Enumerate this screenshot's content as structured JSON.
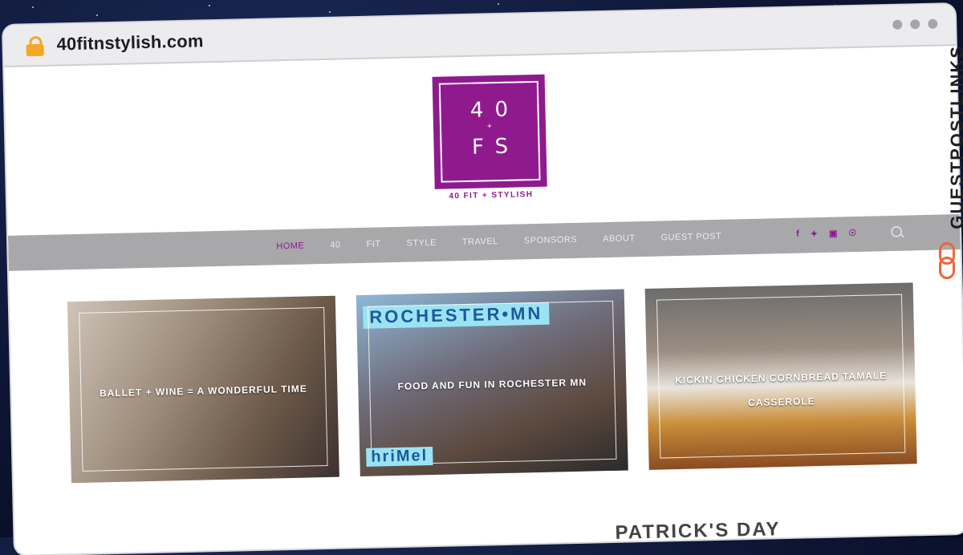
{
  "browser": {
    "url": "40fitnstylish.com"
  },
  "logo": {
    "line1": "40",
    "plus": "+",
    "line2": "FS",
    "tagline": "40 FIT + STYLISH"
  },
  "nav": {
    "items": [
      {
        "label": "HOME",
        "active": true
      },
      {
        "label": "40"
      },
      {
        "label": "FIT"
      },
      {
        "label": "STYLE"
      },
      {
        "label": "TRAVEL"
      },
      {
        "label": "SPONSORS"
      },
      {
        "label": "ABOUT"
      },
      {
        "label": "GUEST POST"
      }
    ],
    "social": [
      "f",
      "twitter",
      "instagram",
      "pinterest"
    ]
  },
  "cards": [
    {
      "title": "BALLET + WINE = A WONDERFUL TIME"
    },
    {
      "title": "FOOD AND FUN IN ROCHESTER MN",
      "banner_top": "ROCHESTER•MN",
      "banner_bottom": "hriMel"
    },
    {
      "title": "KICKIN CHICKEN CORNBREAD TAMALE CASSEROLE"
    }
  ],
  "bottom_heading": "PATRICK'S DAY",
  "watermark": "GUESTPOSTLINKS",
  "colors": {
    "brand": "#8e1a8e",
    "nav_bg": "#a8a8ab",
    "lock": "#f3a826",
    "watermark_icon": "#f0643a"
  }
}
